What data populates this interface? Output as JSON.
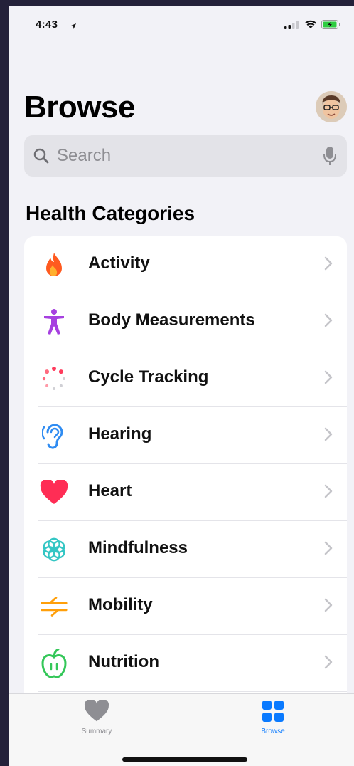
{
  "status_bar": {
    "time": "4:43",
    "icons": [
      "location-arrow-icon",
      "signal-icon",
      "wifi-icon",
      "battery-icon"
    ]
  },
  "header": {
    "title": "Browse",
    "avatar": "memoji-avatar"
  },
  "search": {
    "placeholder": "Search",
    "value": ""
  },
  "section": {
    "title": "Health Categories"
  },
  "categories": [
    {
      "label": "Activity",
      "icon": "flame-icon",
      "color": "#ff5a1f"
    },
    {
      "label": "Body Measurements",
      "icon": "figure-icon",
      "color": "#a640e0"
    },
    {
      "label": "Cycle Tracking",
      "icon": "cycle-icon",
      "color": "#ff3b5c"
    },
    {
      "label": "Hearing",
      "icon": "ear-icon",
      "color": "#2f8cf2"
    },
    {
      "label": "Heart",
      "icon": "heart-icon",
      "color": "#ff2d55"
    },
    {
      "label": "Mindfulness",
      "icon": "flower-icon",
      "color": "#34c6c4"
    },
    {
      "label": "Mobility",
      "icon": "arrows-icon",
      "color": "#ff9f0a"
    },
    {
      "label": "Nutrition",
      "icon": "apple-icon",
      "color": "#34c759"
    }
  ],
  "tab_bar": {
    "summary_label": "Summary",
    "browse_label": "Browse",
    "active": "Browse",
    "active_color": "#0a7aff",
    "inactive_color": "#8e8e93"
  }
}
